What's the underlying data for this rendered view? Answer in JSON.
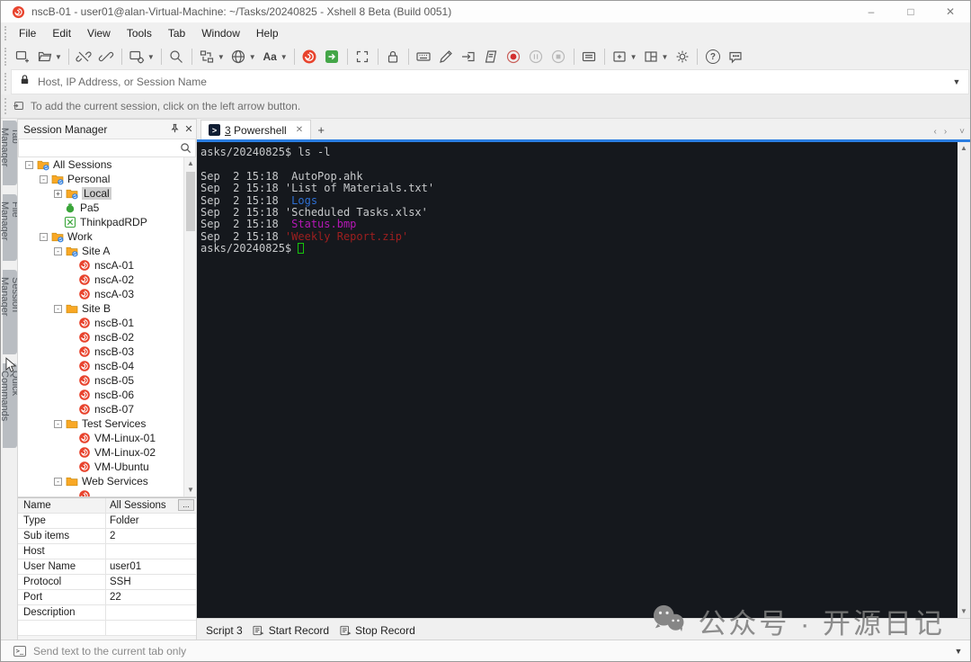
{
  "window": {
    "title": "nscB-01 - user01@alan-Virtual-Machine: ~/Tasks/20240825 - Xshell 8 Beta (Build 0051)",
    "controls": {
      "minimize": "–",
      "maximize": "□",
      "close": "✕"
    }
  },
  "menu": {
    "items": [
      "File",
      "Edit",
      "View",
      "Tools",
      "Tab",
      "Window",
      "Help"
    ]
  },
  "toolbar": {
    "items": [
      {
        "icon": "new-session"
      },
      {
        "icon": "open-folder",
        "caret": true
      },
      {
        "sep": true
      },
      {
        "icon": "disconnect"
      },
      {
        "icon": "reconnect"
      },
      {
        "sep": true
      },
      {
        "icon": "session-properties",
        "caret": true
      },
      {
        "sep": true
      },
      {
        "icon": "find"
      },
      {
        "sep": true
      },
      {
        "icon": "transfer",
        "caret": true
      },
      {
        "icon": "encoding-globe",
        "caret": true
      },
      {
        "icon": "font-aa",
        "caret": true
      },
      {
        "sep": true
      },
      {
        "icon": "xshell-logo"
      },
      {
        "icon": "xftp-logo"
      },
      {
        "sep": true
      },
      {
        "icon": "fullscreen"
      },
      {
        "sep": true
      },
      {
        "icon": "lock"
      },
      {
        "sep": true
      },
      {
        "icon": "keyboard"
      },
      {
        "icon": "compose"
      },
      {
        "icon": "send-to"
      },
      {
        "icon": "script"
      },
      {
        "icon": "record"
      },
      {
        "icon": "pause"
      },
      {
        "icon": "stop"
      },
      {
        "sep": true
      },
      {
        "icon": "quick-commands"
      },
      {
        "sep": true
      },
      {
        "icon": "new-tab",
        "caret": true
      },
      {
        "icon": "tile-layout",
        "caret": true
      },
      {
        "icon": "settings-gear"
      },
      {
        "sep": true
      },
      {
        "icon": "help"
      },
      {
        "icon": "feedback"
      }
    ]
  },
  "address_bar": {
    "placeholder": "Host, IP Address, or Session Name"
  },
  "hint_bar": {
    "text": "To add the current session, click on the left arrow button."
  },
  "left_tabs": {
    "items": [
      {
        "label": "Tab Manager"
      },
      {
        "label": "File Manager"
      },
      {
        "label": "Session Manager"
      },
      {
        "label": "Quick Commands"
      }
    ]
  },
  "session_manager": {
    "title": "Session Manager",
    "search_placeholder": "",
    "tree": [
      {
        "label": "All Sessions",
        "icon": "folder-sync",
        "level": 0,
        "expander": "-"
      },
      {
        "label": "Personal",
        "icon": "folder-sync",
        "level": 1,
        "expander": "-"
      },
      {
        "label": "Local",
        "icon": "folder-sync",
        "level": 2,
        "expander": "+",
        "selected": true
      },
      {
        "label": "Pa5",
        "icon": "pa5",
        "level": 2
      },
      {
        "label": "ThinkpadRDP",
        "icon": "rdp",
        "level": 2
      },
      {
        "label": "Work",
        "icon": "folder-sync",
        "level": 1,
        "expander": "-"
      },
      {
        "label": "Site A",
        "icon": "folder-sync",
        "level": 2,
        "expander": "-"
      },
      {
        "label": "nscA-01",
        "icon": "xshell-session",
        "level": 3
      },
      {
        "label": "nscA-02",
        "icon": "xshell-session",
        "level": 3
      },
      {
        "label": "nscA-03",
        "icon": "xshell-session",
        "level": 3
      },
      {
        "label": "Site B",
        "icon": "folder",
        "level": 2,
        "expander": "-"
      },
      {
        "label": "nscB-01",
        "icon": "xshell-session",
        "level": 3
      },
      {
        "label": "nscB-02",
        "icon": "xshell-session",
        "level": 3
      },
      {
        "label": "nscB-03",
        "icon": "xshell-session",
        "level": 3
      },
      {
        "label": "nscB-04",
        "icon": "xshell-session",
        "level": 3
      },
      {
        "label": "nscB-05",
        "icon": "xshell-session",
        "level": 3
      },
      {
        "label": "nscB-06",
        "icon": "xshell-session",
        "level": 3
      },
      {
        "label": "nscB-07",
        "icon": "xshell-session",
        "level": 3
      },
      {
        "label": "Test Services",
        "icon": "folder",
        "level": 2,
        "expander": "-"
      },
      {
        "label": "VM-Linux-01",
        "icon": "xshell-session",
        "level": 3
      },
      {
        "label": "VM-Linux-02",
        "icon": "xshell-session",
        "level": 3
      },
      {
        "label": "VM-Ubuntu",
        "icon": "xshell-session",
        "level": 3
      },
      {
        "label": "Web Services",
        "icon": "folder",
        "level": 2,
        "expander": "-"
      },
      {
        "label": "",
        "icon": "xshell-session",
        "level": 3
      }
    ]
  },
  "properties": {
    "rows": [
      {
        "label": "Name",
        "value": "All Sessions",
        "button": "...",
        "selected": true
      },
      {
        "label": "Type",
        "value": "Folder"
      },
      {
        "label": "Sub items",
        "value": "2"
      },
      {
        "label": "Host",
        "value": ""
      },
      {
        "label": "User Name",
        "value": "user01"
      },
      {
        "label": "Protocol",
        "value": "SSH"
      },
      {
        "label": "Port",
        "value": "22"
      },
      {
        "label": "Description",
        "value": ""
      },
      {
        "label": "",
        "value": ""
      }
    ]
  },
  "terminal_tabs": {
    "active": {
      "number": "3",
      "label": "Powershell",
      "close": "✕"
    },
    "add": "+",
    "nav": {
      "prev": "‹",
      "next": "›",
      "list": "˅"
    }
  },
  "terminal": {
    "colors": {
      "default": "#c8cacc",
      "dir": "#2d6fd2",
      "image": "#b517b5",
      "archive": "#9e1f1f",
      "cursor": "#16c60c",
      "background": "#15181d",
      "accent_line": "#2a7de1"
    },
    "lines": [
      [
        {
          "t": "asks/20240825$ ls -l"
        }
      ],
      [],
      [
        {
          "t": "Sep  2 15:18  AutoPop.ahk"
        }
      ],
      [
        {
          "t": "Sep  2 15:18 'List of Materials.txt'"
        }
      ],
      [
        {
          "t": "Sep  2 15:18  "
        },
        {
          "t": "Logs",
          "c": "dir"
        }
      ],
      [
        {
          "t": "Sep  2 15:18 'Scheduled Tasks.xlsx'"
        }
      ],
      [
        {
          "t": "Sep  2 15:18  "
        },
        {
          "t": "Status.bmp",
          "c": "image"
        }
      ],
      [
        {
          "t": "Sep  2 15:18 "
        },
        {
          "t": "'Weekly Report.zip'",
          "c": "archive"
        }
      ],
      [
        {
          "t": "asks/20240825$ "
        },
        {
          "cursor": true
        }
      ]
    ]
  },
  "script_bar": {
    "items": [
      {
        "label": "Script 3"
      },
      {
        "icon": "script-record",
        "label": "Start Record"
      },
      {
        "icon": "script-record",
        "label": "Stop Record"
      }
    ]
  },
  "send_bar": {
    "placeholder": "Send text to the current tab only"
  },
  "watermark": {
    "text": "公众号 · 开源日记"
  },
  "brand_colors": {
    "xshell_red": "#e8432d",
    "xftp_green": "#44a648",
    "folder_orange": "#f9a825"
  }
}
